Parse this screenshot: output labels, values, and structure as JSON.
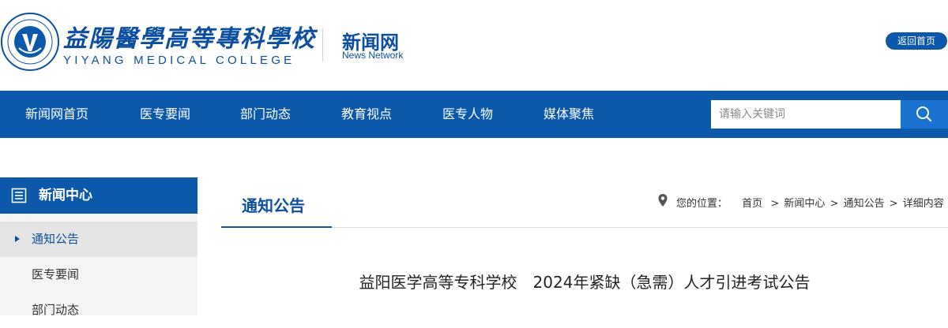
{
  "header": {
    "school_name_cn": "益陽醫學高等專科學校",
    "school_name_en": "YIYANG MEDICAL COLLEGE",
    "news_title": "新闻网",
    "news_subtitle": "News Network",
    "back_button": "返回首页",
    "colors": {
      "brand": "#0c59ab",
      "text_blue": "#0c4fa0"
    }
  },
  "nav": {
    "items": [
      {
        "label": "新闻网首页"
      },
      {
        "label": "医专要闻"
      },
      {
        "label": "部门动态"
      },
      {
        "label": "教育视点"
      },
      {
        "label": "医专人物"
      },
      {
        "label": "媒体聚焦"
      }
    ],
    "search_placeholder": "请输入关键词",
    "search_icon": "search-icon"
  },
  "sidebar": {
    "title": "新闻中心",
    "title_icon": "list-document-icon",
    "items": [
      {
        "label": "通知公告",
        "active": true
      },
      {
        "label": "医专要闻",
        "active": false
      },
      {
        "label": "部门动态",
        "active": false
      }
    ]
  },
  "content": {
    "tab_label": "通知公告",
    "breadcrumb": {
      "prefix": "您的位置：",
      "items": [
        "首页",
        "新闻中心",
        "通知公告",
        "详细内容"
      ],
      "separator": ">"
    },
    "article_title": "益阳医学高等专科学校　2024年紧缺（急需）人才引进考试公告"
  }
}
